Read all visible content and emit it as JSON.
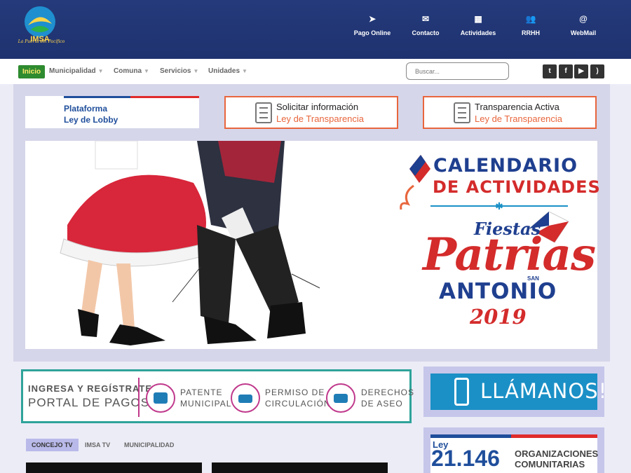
{
  "header": {
    "logo_name": "IMSA",
    "logo_tagline": "La Puerta del Pacífico",
    "quick_links": [
      {
        "icon": "paper-plane-icon",
        "glyph": "➤",
        "label": "Pago Online"
      },
      {
        "icon": "envelope-icon",
        "glyph": "✉",
        "label": "Contacto"
      },
      {
        "icon": "calendar-icon",
        "glyph": "▦",
        "label": "Actividades"
      },
      {
        "icon": "users-icon",
        "glyph": "👥",
        "label": "RRHH"
      },
      {
        "icon": "at-icon",
        "glyph": "@",
        "label": "WebMail"
      }
    ]
  },
  "nav": {
    "home": "Inicio",
    "items": [
      "Municipalidad",
      "Comuna",
      "Servicios",
      "Unidades"
    ],
    "search_placeholder": "Buscar...",
    "social": [
      {
        "icon": "twitter-icon",
        "glyph": "t"
      },
      {
        "icon": "facebook-icon",
        "glyph": "f"
      },
      {
        "icon": "youtube-icon",
        "glyph": "▶"
      },
      {
        "icon": "rss-icon",
        "glyph": ")"
      }
    ]
  },
  "links": {
    "lobby_line1": "Plataforma",
    "lobby_line2": "Ley de Lobby",
    "solicitar_line1": "Solicitar información",
    "solicitar_line2": "Ley de Transparencia",
    "transparencia_line1": "Transparencia Activa",
    "transparencia_line2": "Ley de Transparencia"
  },
  "banner": {
    "line1": "CALENDARIO",
    "line2": "DE ACTIVIDADES",
    "fiestas": "Fiestas",
    "patrias": "Patrias",
    "san": "SAN",
    "antonio": "ANTONIO",
    "year": "2019"
  },
  "portal": {
    "title1": "INGRESA Y REGÍSTRATE",
    "title2": "PORTAL DE PAGOS",
    "items": [
      {
        "icon": "cash-register-icon",
        "line1": "PATENTE",
        "line2": "MUNICIPAL"
      },
      {
        "icon": "car-icon",
        "line1": "PERMISO DE",
        "line2": "CIRCULACIÓN"
      },
      {
        "icon": "truck-icon",
        "line1": "DERECHOS",
        "line2": "DE ASEO"
      }
    ]
  },
  "call": {
    "label": "LLÁMANOS!"
  },
  "ley": {
    "prefix": "Ley",
    "number": "21.146",
    "text1": "ORGANIZACIONES",
    "text2": "COMUNITARIAS"
  },
  "tabs": [
    "CONCEJO TV",
    "IMSA TV",
    "MUNICIPALIDAD"
  ],
  "colors": {
    "header_bg": "#243a7a",
    "accent_red": "#d42b2b",
    "accent_blue": "#1f3f8f",
    "teal": "#2fa39a",
    "magenta": "#c0398c"
  }
}
